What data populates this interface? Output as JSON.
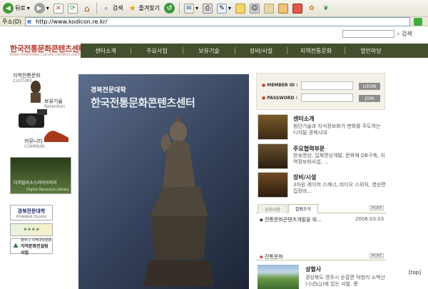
{
  "browser": {
    "toolbar": {
      "back_label": "뒤로",
      "search_label": "검색",
      "favorites_label": "즐겨찾기"
    },
    "address": {
      "label": "주소(D)",
      "url": "http://www.kodicon.re.kr/"
    }
  },
  "site": {
    "search_button": "검색",
    "logo": {
      "korean": "한국전통문화콘텐츠센터",
      "english": "KOREA TRADITIONAL CULTURE CONTENTS CENTER"
    },
    "nav": [
      {
        "label": "센터소개"
      },
      {
        "label": "주요사업"
      },
      {
        "label": "보유기술"
      },
      {
        "label": "장비/시설"
      },
      {
        "label": "지역전통문화"
      },
      {
        "label": "열린마당"
      }
    ],
    "sidebar": {
      "culture_kr": "지역전통문화",
      "culture_en": "CULTURE",
      "retention_kr": "보유기술",
      "retention_en": "Retention",
      "community_kr": "커뮤니티",
      "community_en": "COMMUN",
      "library_kr": "디지털리소스라이브러리",
      "library_en": "Digital Resource Library",
      "banner1_kr": "경북전문대학",
      "banner1_en": "KYUNGBUK COLLEGE",
      "banner3_line1": "영주시 지역대학활용",
      "banner3_line2": "지역문화컨설팅 사업"
    },
    "hero": {
      "university": "경북전문대학",
      "center": "한국전통문화콘텐츠센터"
    },
    "login": {
      "member_id_label": "MEMBER ID :",
      "password_label": "PASSWORD :",
      "login_button": "LOGIN",
      "join_button": "JOIN"
    },
    "features": [
      {
        "title": "센터소개",
        "desc": "첨단기술과 지식정보화가 변화를 주도하는 디지털 경제시대"
      },
      {
        "title": "주요협력부문",
        "desc": "방송영상, 입체영상개발, 문화재 DB구축, 지역정보화사업, ..."
      },
      {
        "title": "장비/시설",
        "desc": "3차원 레이저 스캐너, 비디오 스위처, 영상편집장비..."
      }
    ],
    "tabs": {
      "notice": "공지사항",
      "column": "칼럼소식",
      "more": "MORE"
    },
    "notice_item": {
      "title": "전통문화콘텐츠개발을 위...",
      "date": "2006.03.03"
    },
    "culture": {
      "heading": "전통문화",
      "more": "MORE",
      "title": "성혈사",
      "desc": "경상북도 영주시 순흥면 덕현리 소백산(小白山)에 있는 사찰. 풍"
    },
    "top_link": "[top]"
  }
}
